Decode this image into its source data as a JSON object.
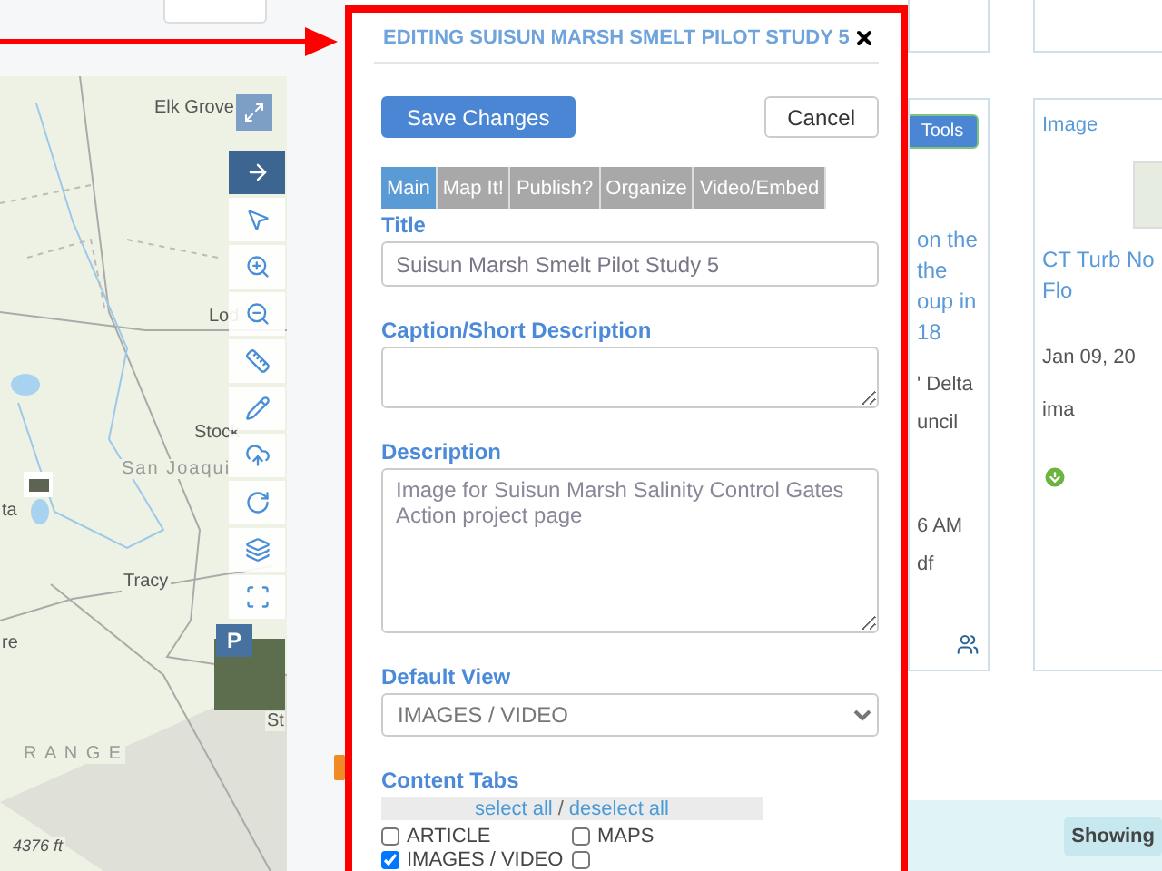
{
  "map": {
    "labels": [
      {
        "text": "Elk Grove",
        "kind": "city"
      },
      {
        "text": "Lod",
        "kind": "city"
      },
      {
        "text": "Stock",
        "kind": "city"
      },
      {
        "text": "San Joaqui",
        "kind": "region"
      },
      {
        "text": "ta",
        "kind": "city"
      },
      {
        "text": "Tracy",
        "kind": "city"
      },
      {
        "text": "re",
        "kind": "city"
      },
      {
        "text": "St",
        "kind": "city"
      },
      {
        "text": "R A N G E",
        "kind": "region"
      },
      {
        "text": "4376 ft",
        "kind": "elevation"
      }
    ],
    "basemap_button": "P"
  },
  "modal": {
    "title": "EDITING SUISUN MARSH SMELT PILOT STUDY 5",
    "buttons": [
      {
        "label": "Save Changes",
        "kind": "primary"
      },
      {
        "label": "Cancel",
        "kind": "secondary"
      }
    ],
    "tabs": [
      {
        "label": "Main",
        "selected": true
      },
      {
        "label": "Map It!",
        "selected": false
      },
      {
        "label": "Publish?",
        "selected": false
      },
      {
        "label": "Organize",
        "selected": false
      },
      {
        "label": "Video/Embed",
        "selected": false
      }
    ],
    "fields": [
      {
        "kind": "input",
        "label": "Title",
        "value": "Suisun Marsh Smelt Pilot Study 5"
      },
      {
        "kind": "textarea",
        "label": "Caption/Short Description"
      },
      {
        "kind": "tallarea",
        "label": "Description",
        "value": "Image for Suisun Marsh Salinity Control Gates Action project page"
      },
      {
        "kind": "select",
        "label": "Default View",
        "value": "IMAGES / VIDEO"
      }
    ],
    "content_tabs": {
      "label": "Content Tabs",
      "select_all": "select all",
      "separator": "/",
      "deselect_all": "deselect all",
      "options": [
        {
          "label": "ARTICLE",
          "checked": false
        },
        {
          "label": "MAPS",
          "checked": false
        },
        {
          "label": "IMAGES / VIDEO",
          "checked": true
        },
        {
          "checked": false
        }
      ]
    }
  },
  "cards": [
    {
      "kind": "partial",
      "tools_button": "Tools",
      "title_lines": [
        "on the",
        "the",
        "oup in",
        "18"
      ],
      "meta": [
        "' Delta",
        "uncil",
        "6 AM",
        "df"
      ]
    },
    {
      "kind": "image",
      "type": "Image",
      "title_lines": [
        "CT Turb No",
        "Flo"
      ],
      "date": "Jan 09, 20",
      "meta": [
        "ima"
      ]
    }
  ],
  "status": {
    "showing": "Showing"
  }
}
